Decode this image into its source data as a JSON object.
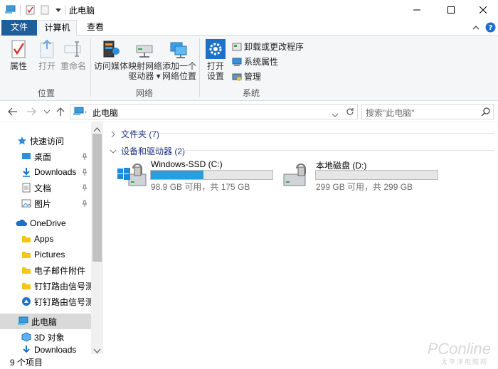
{
  "window": {
    "title": "此电脑"
  },
  "tabs": [
    {
      "label": "文件"
    },
    {
      "label": "计算机"
    },
    {
      "label": "查看"
    }
  ],
  "ribbon": {
    "location_group": {
      "label": "位置",
      "buttons": [
        {
          "label": "属性"
        },
        {
          "label": "打开"
        },
        {
          "label": "重命名"
        }
      ]
    },
    "network_group": {
      "label": "网络",
      "buttons": [
        {
          "label": "访问媒体"
        },
        {
          "label": "映射网络",
          "label2": "驱动器"
        },
        {
          "label": "添加一个",
          "label2": "网络位置"
        }
      ]
    },
    "system_group": {
      "label": "系统",
      "open_settings": {
        "label": "打开",
        "label2": "设置"
      },
      "commands": [
        {
          "label": "卸载或更改程序"
        },
        {
          "label": "系统属性"
        },
        {
          "label": "管理"
        }
      ]
    }
  },
  "address": {
    "path": "此电脑",
    "search_placeholder": "搜索\"此电脑\""
  },
  "nav": {
    "quick_access": "快速访问",
    "items_qa": [
      {
        "label": "桌面",
        "icon": "desktop-icon"
      },
      {
        "label": "Downloads",
        "icon": "downloads-icon"
      },
      {
        "label": "文档",
        "icon": "documents-icon"
      },
      {
        "label": "图片",
        "icon": "pictures-icon"
      }
    ],
    "onedrive": "OneDrive",
    "items_od": [
      {
        "label": "Apps"
      },
      {
        "label": "Pictures"
      },
      {
        "label": "电子邮件附件"
      },
      {
        "label": "钉钉路由信号测试"
      },
      {
        "label": "钉钉路由信号测试"
      }
    ],
    "this_pc": "此电脑",
    "items_pc": [
      {
        "label": "3D 对象"
      },
      {
        "label": "Downloads"
      }
    ]
  },
  "content": {
    "folders_header": "文件夹 (7)",
    "drives_header": "设备和驱动器 (2)",
    "drives": [
      {
        "name": "Windows-SSD (C:)",
        "info": "98.9 GB 可用，共 175 GB",
        "used_fraction": 0.435
      },
      {
        "name": "本地磁盘 (D:)",
        "info": "299 GB 可用，共 299 GB",
        "used_fraction": 0.0
      }
    ]
  },
  "status": {
    "count": "9 个项目"
  },
  "watermark": {
    "text": "PConline",
    "sub": "太平洋电脑网"
  },
  "colors": {
    "accent": "#1e5e9b",
    "drive_bar": "#26a0da",
    "group_header": "#1e3287"
  }
}
